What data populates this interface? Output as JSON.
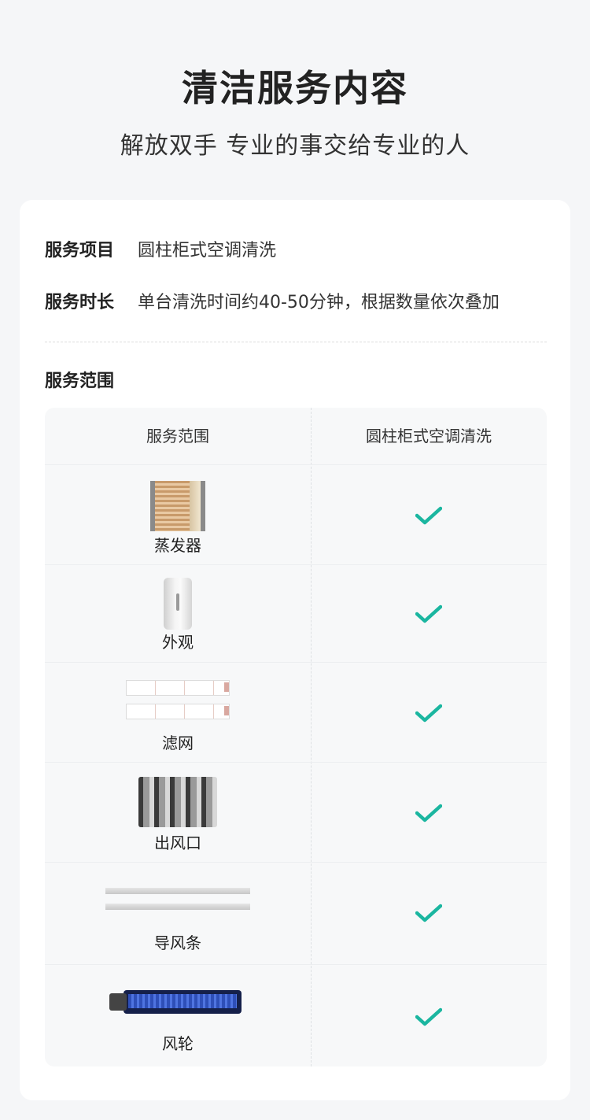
{
  "header": {
    "title": "清洁服务内容",
    "subtitle": "解放双手 专业的事交给专业的人"
  },
  "info": [
    {
      "label": "服务项目",
      "value": "圆柱柜式空调清洗"
    },
    {
      "label": "服务时长",
      "value": "单台清洗时间约40-50分钟，根据数量依次叠加"
    }
  ],
  "scope": {
    "title": "服务范围",
    "columns": [
      "服务范围",
      "圆柱柜式空调清洗"
    ],
    "rows": [
      {
        "label": "蒸发器",
        "included": true,
        "icon": "evaporator-image"
      },
      {
        "label": "外观",
        "included": true,
        "icon": "exterior-image"
      },
      {
        "label": "滤网",
        "included": true,
        "icon": "filter-image"
      },
      {
        "label": "出风口",
        "included": true,
        "icon": "air-outlet-image"
      },
      {
        "label": "导风条",
        "included": true,
        "icon": "air-guide-strip-image"
      },
      {
        "label": "风轮",
        "included": true,
        "icon": "fan-wheel-image"
      }
    ]
  },
  "colors": {
    "check": "#1bb6a0",
    "background": "#f5f6f8",
    "card": "#ffffff",
    "table": "#f7f8f9"
  }
}
